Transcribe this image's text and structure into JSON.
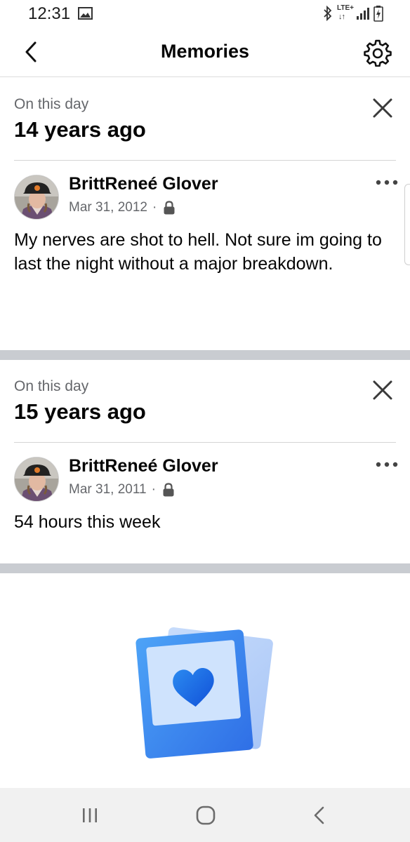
{
  "status_bar": {
    "time": "12:31",
    "network_badge": "LTE+",
    "network_arrows": "↓↑",
    "icons": [
      "image-icon",
      "bluetooth-icon",
      "signal-icon",
      "battery-charging-icon"
    ]
  },
  "header": {
    "title": "Memories",
    "back_icon": "chevron-left-icon",
    "settings_icon": "gear-icon"
  },
  "memories": [
    {
      "label": "On this day",
      "years_ago": "14 years ago",
      "author": "BrittReneé Glover",
      "date": "Mar 31, 2012",
      "separator": "·",
      "privacy_icon": "lock-icon",
      "text": "My nerves are shot to hell. Not sure im going to last the night without a major breakdown."
    },
    {
      "label": "On this day",
      "years_ago": "15 years ago",
      "author": "BrittReneé Glover",
      "date": "Mar 31, 2011",
      "separator": "·",
      "privacy_icon": "lock-icon",
      "text": "54 hours this week"
    }
  ],
  "colors": {
    "text_primary": "#050505",
    "text_secondary": "#65676b",
    "section_gap": "#c9ccd1",
    "accent_blue": "#2d7ff2",
    "heart_blue": "#1565e8"
  },
  "nav_bar": {
    "icons": [
      "recent-apps-icon",
      "home-icon",
      "back-icon"
    ]
  }
}
